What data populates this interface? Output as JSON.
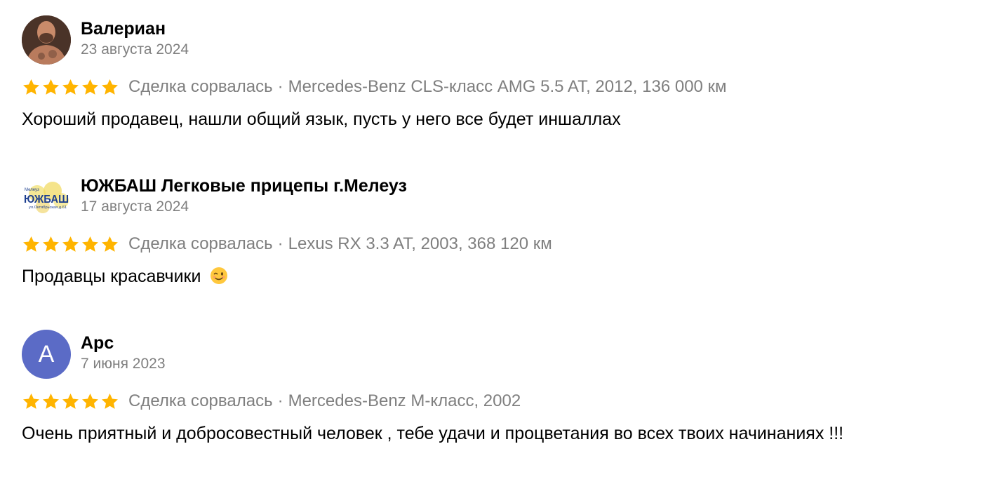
{
  "reviews": [
    {
      "author": "Валериан",
      "date": "23 августа 2024",
      "avatar": {
        "type": "photo",
        "icon": "user-photo"
      },
      "rating": 5,
      "status": "Сделка сорвалась",
      "separator": "·",
      "vehicle": "Mercedes-Benz CLS-класс AMG 5.5 AT, 2012, 136 000 км",
      "text": "Хороший продавец, нашли общий язык, пусть у него все будет иншаллах"
    },
    {
      "author": "ЮЖБАШ Легковые прицепы г.Мелеуз",
      "date": "17 августа 2024",
      "avatar": {
        "type": "logo",
        "icon": "yuzhbash-logo",
        "logo_top": "Мелеуз",
        "logo_main": "ЮЖБАШ",
        "logo_bottom": "ул.Октябрьская д.61"
      },
      "rating": 5,
      "status": "Сделка сорвалась",
      "separator": "·",
      "vehicle": "Lexus RX 3.3 AT, 2003, 368 120 км",
      "text": "Продавцы красавчики",
      "emoji": "winking-face-emoji"
    },
    {
      "author": "Арс",
      "date": "7 июня 2023",
      "avatar": {
        "type": "letter",
        "letter": "А",
        "color": "#5b6bc6"
      },
      "rating": 5,
      "status": "Сделка сорвалась",
      "separator": "·",
      "vehicle": "Mercedes-Benz M-класс, 2002",
      "text": "Очень приятный и добросовестный человек , тебе удачи и процветания во всех твоих начинаниях !!!"
    }
  ],
  "colors": {
    "star": "#ffb400",
    "secondary_text": "#7f7f7f",
    "primary_text": "#000000",
    "letter_avatar": "#5b6bc6"
  }
}
